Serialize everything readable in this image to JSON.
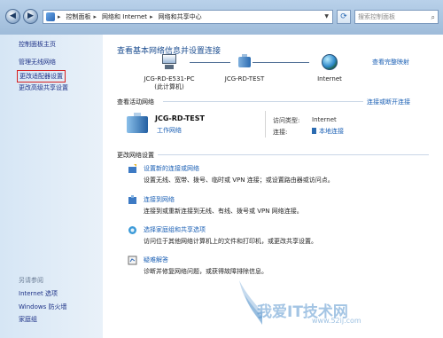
{
  "addressbar": {
    "crumbs": [
      "控制面板",
      "网络和 Internet",
      "网络和共享中心"
    ],
    "search_placeholder": "搜索控制面板"
  },
  "sidebar": {
    "home": "控制面板主页",
    "items": [
      "管理无线网络",
      "更改适配器设置",
      "更改高级共享设置"
    ],
    "see_also_header": "另请参阅",
    "see_also": [
      "Internet 选项",
      "Windows 防火墙",
      "家庭组"
    ]
  },
  "main": {
    "title": "查看基本网络信息并设置连接",
    "full_map": "查看完整映射",
    "map": {
      "computer_name": "JCG-RD-E531-PC",
      "computer_sub": "(此计算机)",
      "network_name": "JCG-RD-TEST",
      "internet": "Internet"
    },
    "active_title": "查看活动网络",
    "connect_or_disconnect": "连接或断开连接",
    "active_network": {
      "name": "JCG-RD-TEST",
      "type": "工作网络",
      "access_type_label": "访问类型:",
      "access_type_value": "Internet",
      "connection_label": "连接:",
      "connection_value": "本地连接"
    },
    "change_title": "更改网络设置",
    "tasks": [
      {
        "link": "设置新的连接或网络",
        "desc": "设置无线、宽带、拨号、临时或 VPN 连接；或设置路由器或访问点。"
      },
      {
        "link": "连接到网络",
        "desc": "连接到或重新连接到无线、有线、拨号或 VPN 网络连接。"
      },
      {
        "link": "选择家庭组和共享选项",
        "desc": "访问位于其他网络计算机上的文件和打印机，或更改共享设置。"
      },
      {
        "link": "疑难解答",
        "desc": "诊断并修复网络问题，或获得故障排除信息。"
      }
    ]
  },
  "watermark": {
    "text": "我爱IT技术网",
    "url": "www.52ij.com"
  },
  "colors": {
    "link": "#1a5fb4",
    "sidebar_link": "#1e3287",
    "highlight_box": "#d62020"
  }
}
